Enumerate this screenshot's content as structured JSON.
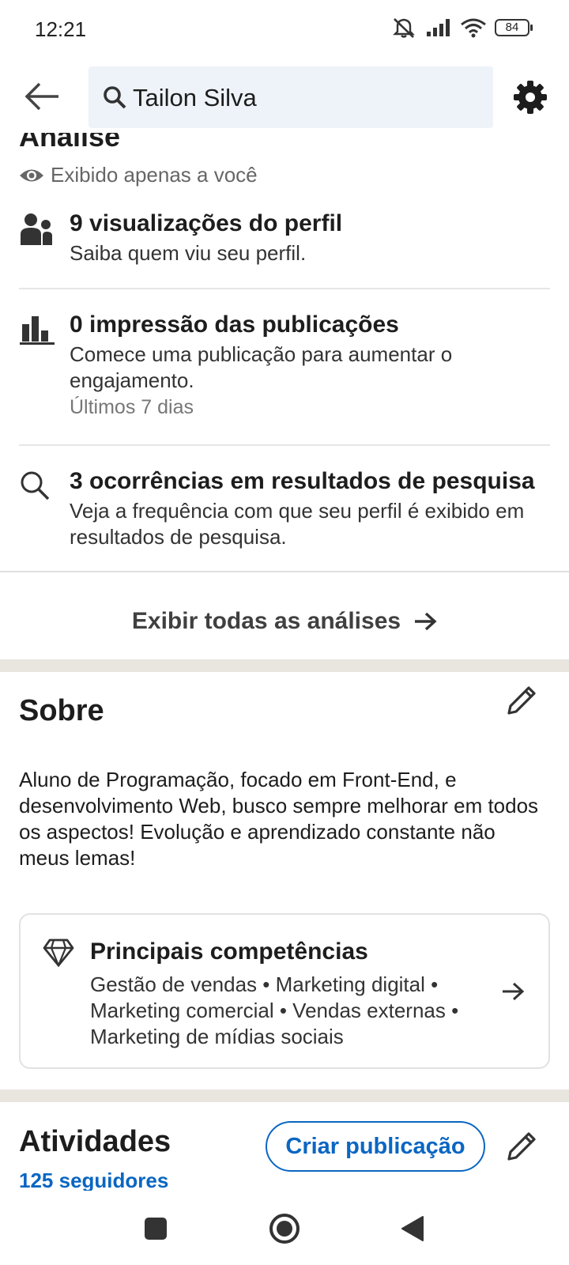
{
  "status_bar": {
    "time": "12:21",
    "battery": "84",
    "icons": [
      "mute-icon",
      "signal-icon",
      "wifi-icon",
      "battery-icon"
    ]
  },
  "top_bar": {
    "search_value": "Tailon Silva",
    "icons": [
      "back-arrow-icon",
      "search-icon",
      "gear-icon"
    ]
  },
  "analysis": {
    "title": "Análise",
    "privacy": "Exibido apenas a você",
    "items": [
      {
        "icon": "people-icon",
        "title": "9 visualizações do perfil",
        "subtitle": "Saiba quem viu seu perfil."
      },
      {
        "icon": "bar-chart-icon",
        "title": "0 impressão das publicações",
        "subtitle": "Comece uma publicação para aumentar o engajamento.",
        "meta": "Últimos 7 dias"
      },
      {
        "icon": "search-icon",
        "title": "3 ocorrências em resultados de pesquisa",
        "subtitle": "Veja a frequência com que seu perfil é exibido em resultados de pesquisa."
      }
    ],
    "show_all": "Exibir todas as análises"
  },
  "about": {
    "title": "Sobre",
    "text": "Aluno de Programação, focado em Front-End, e desenvolvimento Web, busco sempre melhorar em todos os aspectos! Evolução e aprendizado constante não meus lemas!",
    "skills_title": "Principais competências",
    "skills": "Gestão de vendas • Marketing digital • Marketing comercial • Vendas externas • Marketing de mídias sociais"
  },
  "activities": {
    "title": "Atividades",
    "followers": "125 seguidores",
    "create_post": "Criar publicação"
  },
  "colors": {
    "accent": "#0a66c2",
    "search_bg": "#edf3f8",
    "section_gap": "#e9e5df"
  }
}
